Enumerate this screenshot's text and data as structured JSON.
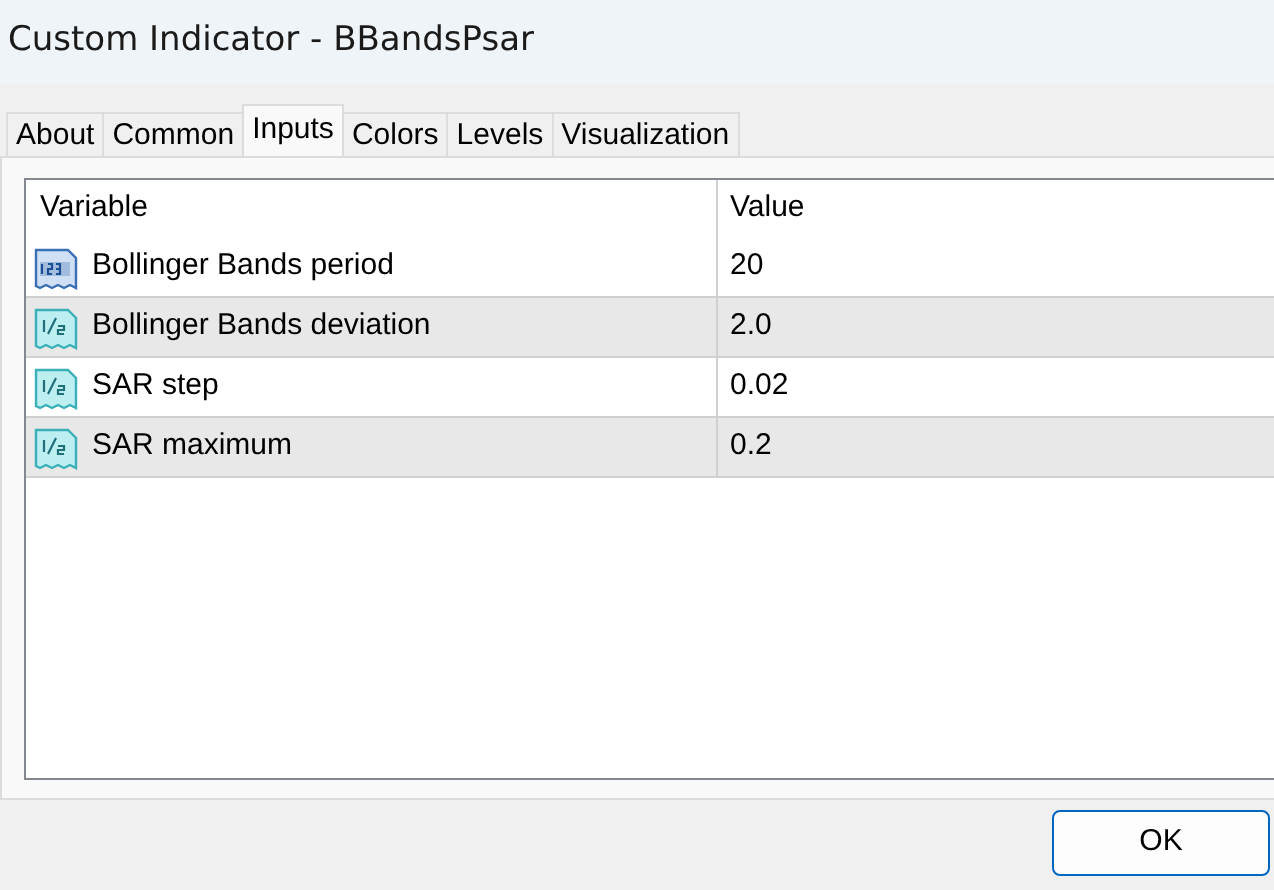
{
  "window": {
    "title": "Custom Indicator - BBandsPsar"
  },
  "tabs": [
    {
      "label": "About",
      "selected": false
    },
    {
      "label": "Common",
      "selected": false
    },
    {
      "label": "Inputs",
      "selected": true
    },
    {
      "label": "Colors",
      "selected": false
    },
    {
      "label": "Levels",
      "selected": false
    },
    {
      "label": "Visualization",
      "selected": false
    }
  ],
  "table": {
    "columns": [
      "Variable",
      "Value"
    ],
    "rows": [
      {
        "kind": "integer",
        "variable": "Bollinger Bands period",
        "value": "20"
      },
      {
        "kind": "double",
        "variable": "Bollinger Bands deviation",
        "value": "2.0"
      },
      {
        "kind": "double",
        "variable": "SAR step",
        "value": "0.02"
      },
      {
        "kind": "double",
        "variable": "SAR maximum",
        "value": "0.2"
      }
    ]
  },
  "buttons": [
    "OK"
  ]
}
